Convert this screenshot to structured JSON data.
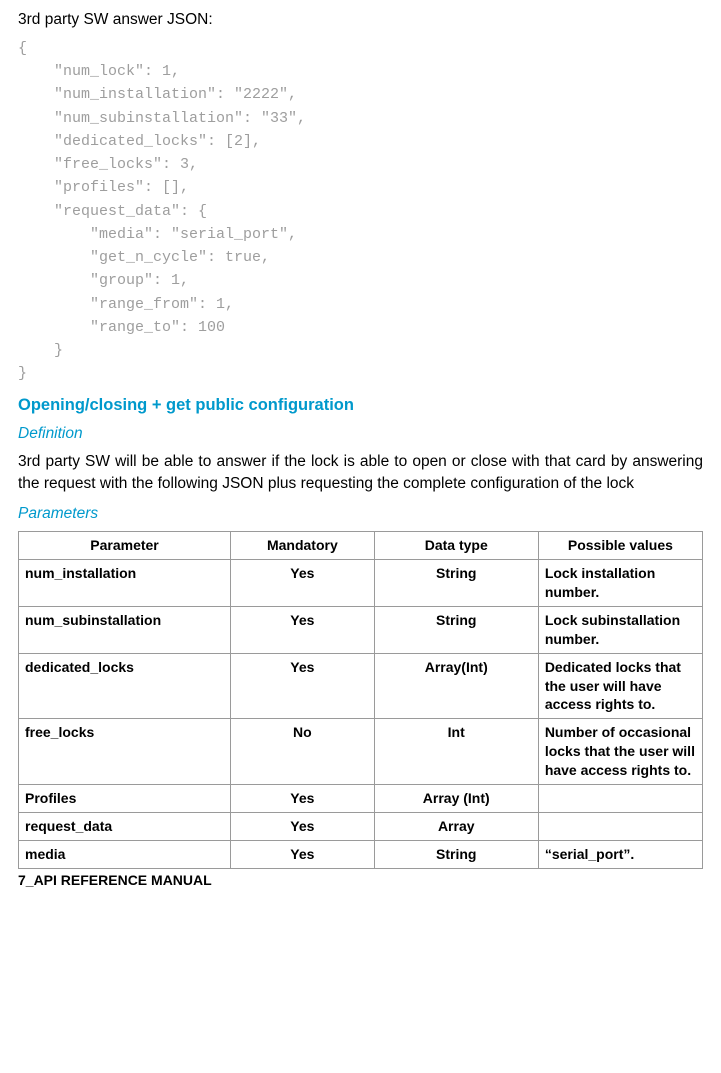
{
  "lead": "3rd party SW answer JSON:",
  "code": "{\n    \"num_lock\": 1,\n    \"num_installation\": \"2222\",\n    \"num_subinstallation\": \"33\",\n    \"dedicated_locks\": [2],\n    \"free_locks\": 3,\n    \"profiles\": [],\n    \"request_data\": {\n        \"media\": \"serial_port\",\n        \"get_n_cycle\": true,\n        \"group\": 1,\n        \"range_from\": 1,\n        \"range_to\": 100\n    }\n}",
  "section_heading": "Opening/closing + get public configuration",
  "definition_label": "Definition",
  "definition_text": "3rd party SW will be able to answer if the lock is able to open or close with that card by answering the request with the following JSON plus requesting the complete configuration of the lock",
  "parameters_label": "Parameters",
  "table": {
    "headers": {
      "c1": "Parameter",
      "c2": "Mandatory",
      "c3": "Data type",
      "c4": "Possible values"
    },
    "rows": [
      {
        "param": "num_installation",
        "mandatory": "Yes",
        "type": "String",
        "values": "Lock installation number."
      },
      {
        "param": "num_subinstallation",
        "mandatory": "Yes",
        "type": "String",
        "values": "Lock subinstallation number."
      },
      {
        "param": "dedicated_locks",
        "mandatory": "Yes",
        "type": "Array(Int)",
        "values": "Dedicated locks that the user will have access rights to."
      },
      {
        "param": "free_locks",
        "mandatory": "No",
        "type": "Int",
        "values": "Number of occasional locks that the user will have access rights to."
      },
      {
        "param": "Profiles",
        "mandatory": "Yes",
        "type": "Array (Int)",
        "values": ""
      },
      {
        "param": "request_data",
        "mandatory": "Yes",
        "type": "Array",
        "values": ""
      },
      {
        "param": "media",
        "mandatory": "Yes",
        "type": "String",
        "values": "“serial_port”."
      }
    ]
  },
  "footer": "7_API REFERENCE MANUAL"
}
